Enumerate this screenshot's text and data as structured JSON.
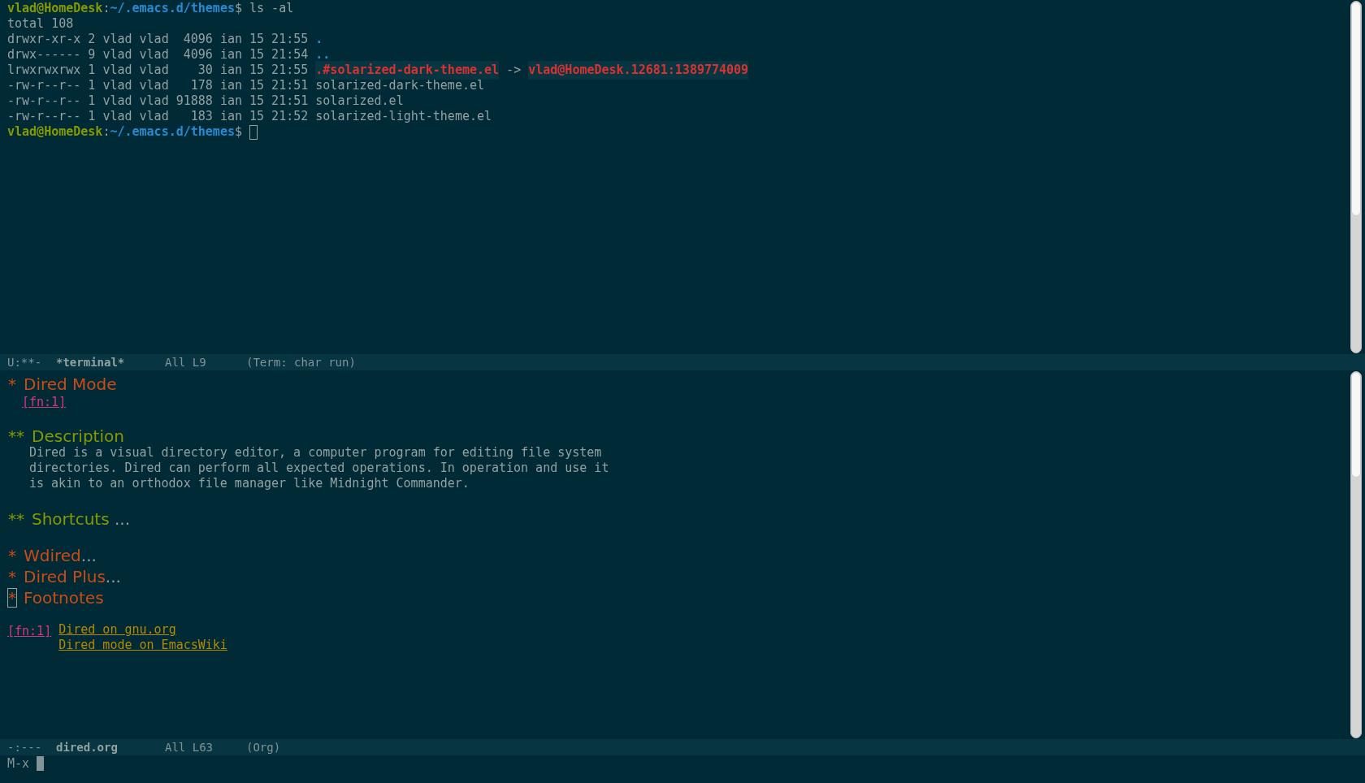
{
  "terminal": {
    "lines": [
      {
        "segments": [
          {
            "kind": "user",
            "text": "vlad@HomeDesk"
          },
          {
            "kind": "plain",
            "text": ":"
          },
          {
            "kind": "path",
            "text": "~/.emacs.d/themes"
          },
          {
            "kind": "plain",
            "text": "$ ls -al"
          }
        ],
        "cursor": false
      },
      {
        "segments": [
          {
            "kind": "plain",
            "text": "total 108"
          }
        ],
        "cursor": false
      },
      {
        "segments": [
          {
            "kind": "plain",
            "text": "drwxr-xr-x 2 vlad vlad  4096 ian 15 21:55 "
          },
          {
            "kind": "dir",
            "text": "."
          }
        ],
        "cursor": false
      },
      {
        "segments": [
          {
            "kind": "plain",
            "text": "drwx------ 9 vlad vlad  4096 ian 15 21:54 "
          },
          {
            "kind": "dir",
            "text": ".."
          }
        ],
        "cursor": false
      },
      {
        "segments": [
          {
            "kind": "plain",
            "text": "lrwxrwxrwx 1 vlad vlad    30 ian 15 21:55 "
          },
          {
            "kind": "broken",
            "text": ".#solarized-dark-theme.el"
          },
          {
            "kind": "plain",
            "text": " -> "
          },
          {
            "kind": "broken",
            "text": "vlad@HomeDesk.12681:1389774009"
          }
        ],
        "cursor": false
      },
      {
        "segments": [
          {
            "kind": "plain",
            "text": "-rw-r--r-- 1 vlad vlad   178 ian 15 21:51 solarized-dark-theme.el"
          }
        ],
        "cursor": false
      },
      {
        "segments": [
          {
            "kind": "plain",
            "text": "-rw-r--r-- 1 vlad vlad 91888 ian 15 21:51 solarized.el"
          }
        ],
        "cursor": false
      },
      {
        "segments": [
          {
            "kind": "plain",
            "text": "-rw-r--r-- 1 vlad vlad   183 ian 15 21:52 solarized-light-theme.el"
          }
        ],
        "cursor": false
      },
      {
        "segments": [
          {
            "kind": "user",
            "text": "vlad@HomeDesk"
          },
          {
            "kind": "plain",
            "text": ":"
          },
          {
            "kind": "path",
            "text": "~/.emacs.d/themes"
          },
          {
            "kind": "plain",
            "text": "$ "
          }
        ],
        "cursor": true
      }
    ]
  },
  "terminal_mode_line": {
    "flags": "U:**-",
    "buffer": "*terminal*",
    "position": "All L9",
    "mode": "(Term: char run)"
  },
  "org": {
    "items": [
      {
        "kind": "heading1",
        "stars": "*",
        "title": "Dired Mode",
        "cursor": false
      },
      {
        "kind": "fnref",
        "text": "[fn:1]"
      },
      {
        "kind": "blank"
      },
      {
        "kind": "heading2",
        "stars": "**",
        "title": "Description",
        "cursor": false
      },
      {
        "kind": "paragraph",
        "lines": [
          "Dired is a visual directory editor, a computer program for editing file system",
          "directories. Dired can perform all expected operations. In operation and use it",
          "is akin to an orthodox file manager like Midnight Commander."
        ]
      },
      {
        "kind": "blank"
      },
      {
        "kind": "heading2",
        "stars": "**",
        "title": "Shortcuts",
        "ellipsis": " ...",
        "cursor": false
      },
      {
        "kind": "blank"
      },
      {
        "kind": "heading1",
        "stars": "*",
        "title": "Wdired",
        "ellipsis": "...",
        "cursor": false
      },
      {
        "kind": "heading1",
        "stars": "*",
        "title": "Dired Plus",
        "ellipsis": "...",
        "cursor": false
      },
      {
        "kind": "heading1",
        "stars": "*",
        "title": "Footnotes",
        "cursor": true
      },
      {
        "kind": "blank"
      },
      {
        "kind": "footnote",
        "label": "[fn:1]",
        "links": [
          "Dired on gnu.org",
          "Dired mode on EmacsWiki"
        ]
      }
    ]
  },
  "org_mode_line": {
    "flags": "-:---",
    "buffer": "dired.org",
    "position": "All L63",
    "mode": "(Org)"
  },
  "minibuffer": {
    "prompt": "M-x"
  }
}
